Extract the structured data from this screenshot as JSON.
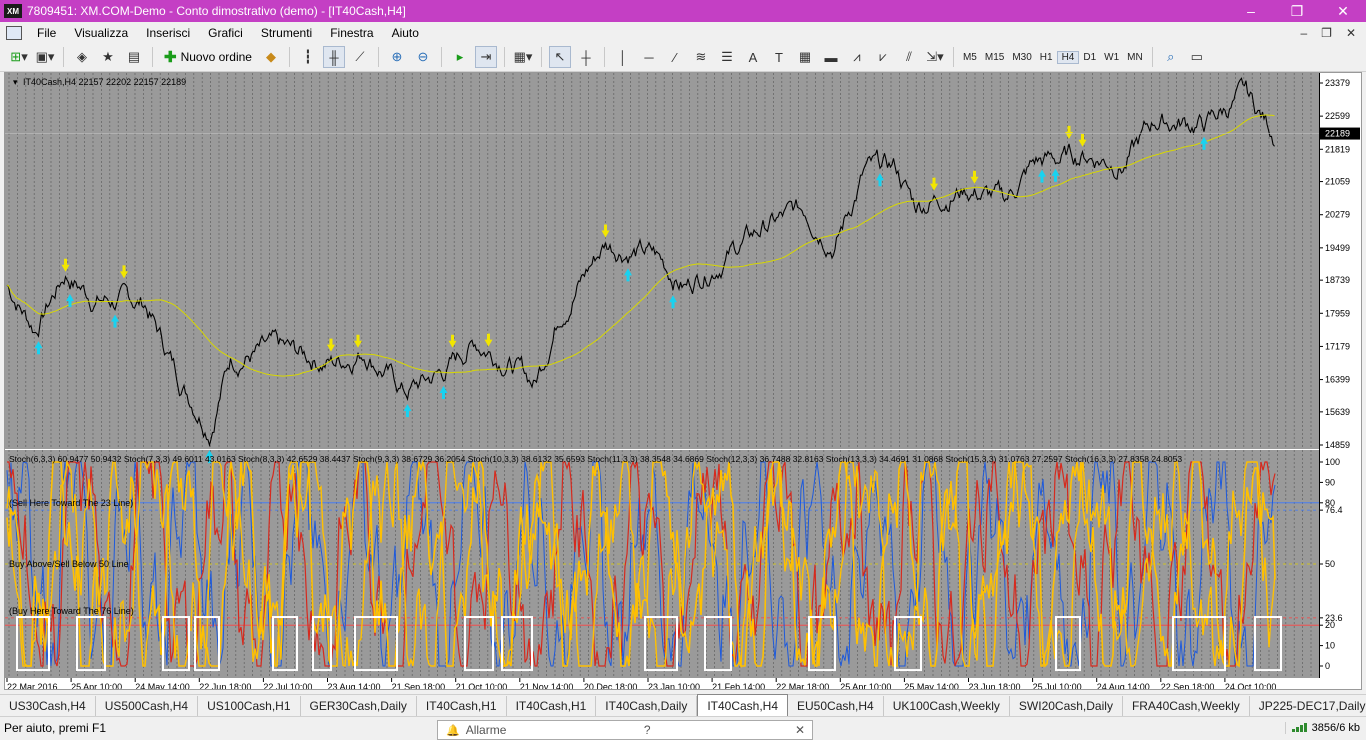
{
  "window": {
    "title": "7809451: XM.COM-Demo - Conto dimostrativo (demo) - [IT40Cash,H4]",
    "logo": "XM",
    "controls": [
      "–",
      "❐",
      "✕"
    ]
  },
  "menu": {
    "items": [
      "File",
      "Visualizza",
      "Inserisci",
      "Grafici",
      "Strumenti",
      "Finestra",
      "Aiuto"
    ],
    "right_controls": [
      "–",
      "❐",
      "✕"
    ]
  },
  "toolbar": {
    "new_order_label": "Nuovo ordine",
    "timeframes": [
      "M5",
      "M15",
      "M30",
      "H1",
      "H4",
      "D1",
      "W1",
      "MN"
    ],
    "active_timeframe": "H4"
  },
  "chart": {
    "header": "IT40Cash,H4  22157 22202 22157 22189",
    "price_ticks": [
      "23379",
      "22599",
      "21819",
      "21059",
      "20279",
      "19499",
      "18739",
      "17959",
      "17179",
      "16399",
      "15639",
      "14859"
    ],
    "current_price": "22189",
    "date_ticks": [
      "22 Mar 2016",
      "25 Apr 10:00",
      "24 May 14:00",
      "22 Jun 18:00",
      "22 Jul 10:00",
      "23 Aug 14:00",
      "21 Sep 18:00",
      "21 Oct 10:00",
      "21 Nov 14:00",
      "20 Dec 18:00",
      "23 Jan 10:00",
      "21 Feb 14:00",
      "22 Mar 18:00",
      "25 Apr 10:00",
      "25 May 14:00",
      "23 Jun 18:00",
      "25 Jul 10:00",
      "24 Aug 14:00",
      "22 Sep 18:00",
      "24 Oct 10:00"
    ],
    "stoch_header": "Stoch(6,3,3) 60.9477 50.9432  Stoch(7,3,3) 49.6011 43.0163  Stoch(8,3,3) 42.6529 38.4437  Stoch(9,3,3) 38.6729 36.2054  Stoch(10,3,3) 38.6132 35.6593  Stoch(11,3,3) 38.3548 34.6869  Stoch(12,3,3) 36.7488 32.8163  Stoch(13,3,3) 34.4691 31.0868  Stoch(15,3,3) 31.0763 27.2597  Stoch(16,3,3) 27.8358 24.8053",
    "stoch_ticks": [
      "100",
      "90",
      "80",
      "76.4",
      "50",
      "23.6",
      "20",
      "10",
      "0"
    ],
    "stoch_labels": [
      "(Sell Here Toward The 23 Line)",
      "Buy Above/Sell Below 50 Line",
      "(Buy Here Toward The 76 Line)"
    ],
    "colors": {
      "price": "#000000",
      "moving_average": "#d8d800",
      "arrow_sell": "#f2e600",
      "arrow_buy": "#19d2f0",
      "stoch_yellow": "#ffc000",
      "stoch_red": "#d62a1e",
      "stoch_blue": "#1e5adc",
      "level_red": "#ff4040",
      "level_blue": "#3a78ff",
      "grid": "#606060",
      "highlight_box": "#ffffff"
    }
  },
  "tabs": {
    "items": [
      "US30Cash,H4",
      "US500Cash,H4",
      "US100Cash,H1",
      "GER30Cash,Daily",
      "IT40Cash,H1",
      "IT40Cash,H1",
      "IT40Cash,Daily",
      "IT40Cash,H4",
      "EU50Cash,H4",
      "UK100Cash,Weekly",
      "SWI20Cash,Daily",
      "FRA40Cash,Weekly",
      "JP225-DEC17,Daily"
    ],
    "active_index": 7,
    "overflow": "◂▸"
  },
  "status": {
    "help": "Per aiuto, premi F1",
    "traffic": "3856/6 kb"
  },
  "alarm_popup": {
    "title": "Allarme",
    "buttons": [
      "?",
      "✕"
    ]
  }
}
